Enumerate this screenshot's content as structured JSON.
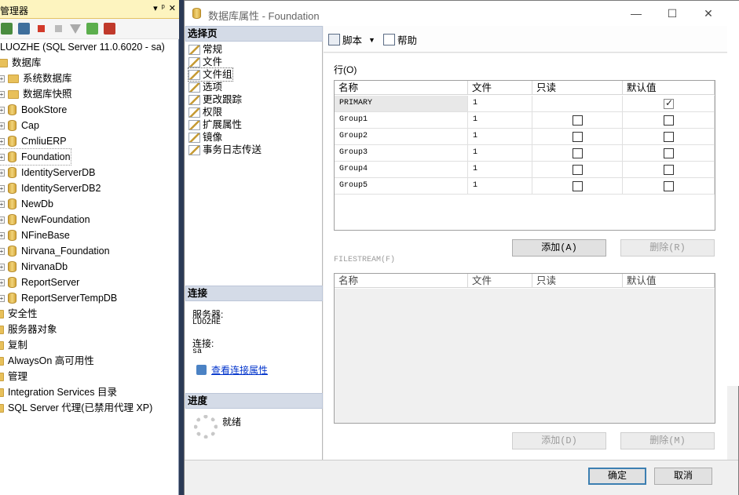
{
  "object_explorer": {
    "title": "管理器",
    "title_buttons": [
      "▾",
      "ᵖ",
      "✕"
    ],
    "server_node": "LUOZHE (SQL Server 11.0.6020 - sa)",
    "databases_label": "数据库",
    "db_folders": [
      "系统数据库",
      "数据库快照"
    ],
    "databases": [
      "BookStore",
      "Cap",
      "CmliuERP",
      "Foundation",
      "IdentityServerDB",
      "IdentityServerDB2",
      "NewDb",
      "NewFoundation",
      "NFineBase",
      "Nirvana_Foundation",
      "NirvanaDb",
      "ReportServer",
      "ReportServerTempDB"
    ],
    "top_nodes": [
      "安全性",
      "服务器对象",
      "复制",
      "AlwaysOn 高可用性",
      "管理",
      "Integration Services 目录",
      "SQL Server 代理(已禁用代理 XP)"
    ]
  },
  "dialog": {
    "title": "数据库属性 - Foundation",
    "window_buttons": [
      "—",
      "☐",
      "✕"
    ],
    "select_page_header": "选择页",
    "pages": [
      "常规",
      "文件",
      "文件组",
      "选项",
      "更改跟踪",
      "权限",
      "扩展属性",
      "镜像",
      "事务日志传送"
    ],
    "connection_header": "连接",
    "server_label": "服务器:",
    "server_value": "LUOZHE",
    "connection_label": "连接:",
    "connection_value": "sa",
    "view_connection_link": "查看连接属性",
    "progress_header": "进度",
    "progress_status": "就绪",
    "toolbar": {
      "script": "脚本",
      "help": "帮助"
    },
    "rows_label": "行(O)",
    "columns": [
      "名称",
      "文件",
      "只读",
      "默认值"
    ],
    "rows": [
      {
        "name": "PRIMARY",
        "files": "1",
        "readonly": false,
        "default": true
      },
      {
        "name": "Group1",
        "files": "1",
        "readonly": false,
        "default": false
      },
      {
        "name": "Group2",
        "files": "1",
        "readonly": false,
        "default": false
      },
      {
        "name": "Group3",
        "files": "1",
        "readonly": false,
        "default": false
      },
      {
        "name": "Group4",
        "files": "1",
        "readonly": false,
        "default": false
      },
      {
        "name": "Group5",
        "files": "1",
        "readonly": false,
        "default": false
      }
    ],
    "add_label": "添加(A)",
    "remove_label": "删除(R)",
    "filestream_label": "FILESTREAM(F)",
    "fs_columns": [
      "名称",
      "文件",
      "只读",
      "默认值"
    ],
    "fs_add_label": "添加(D)",
    "fs_remove_label": "删除(M)",
    "ok_label": "确定",
    "cancel_label": "取消"
  }
}
